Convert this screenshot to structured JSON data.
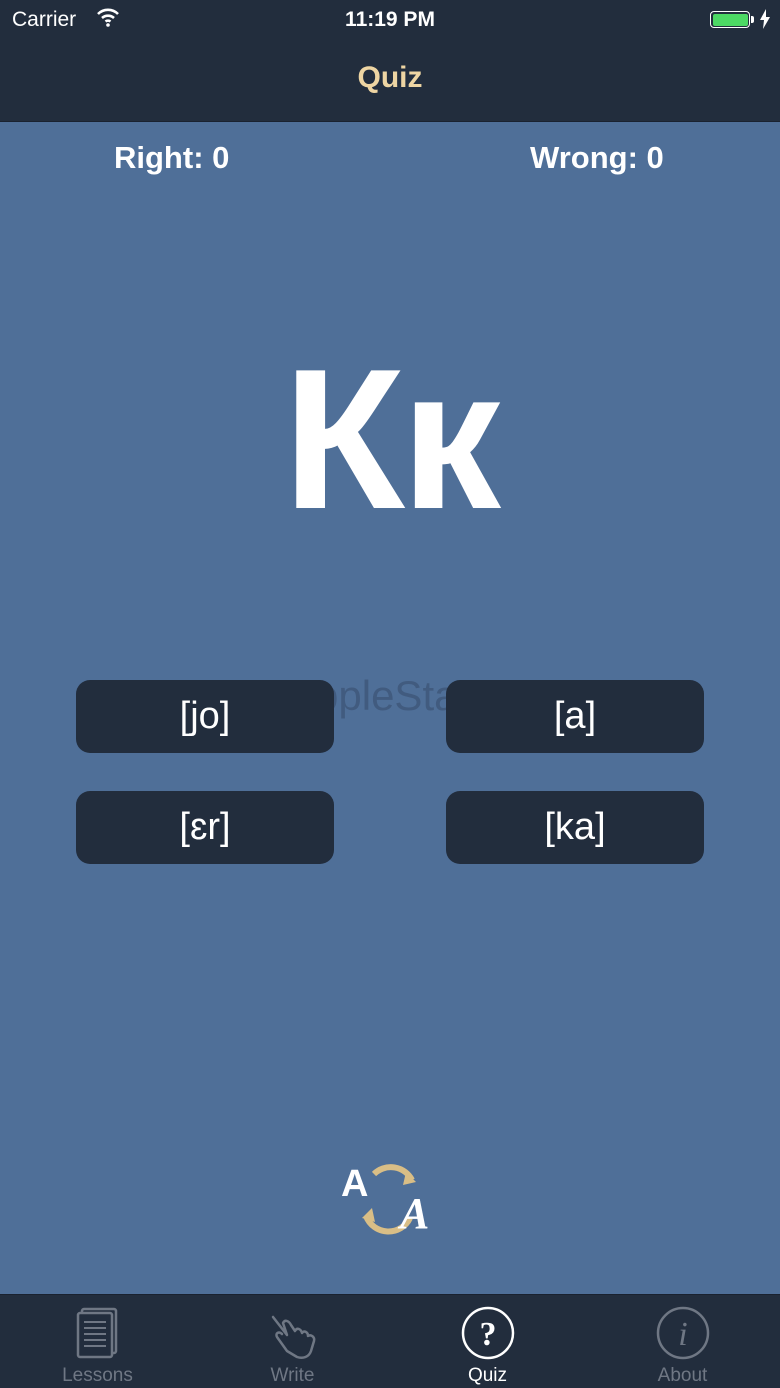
{
  "status_bar": {
    "carrier": "Carrier",
    "time": "11:19 PM"
  },
  "nav": {
    "title": "Quiz"
  },
  "score": {
    "right": "Right: 0",
    "wrong": "Wrong: 0"
  },
  "question": {
    "letter": "Кк"
  },
  "watermark": "JSAppleStar.com",
  "answers": [
    "[jo]",
    "[a]",
    "[ɛr]",
    "[ka]"
  ],
  "logo": {
    "letter_a": "A",
    "letter_script": "A"
  },
  "tabs": [
    {
      "label": "Lessons",
      "icon": "book-icon"
    },
    {
      "label": "Write",
      "icon": "hand-pointer-icon"
    },
    {
      "label": "Quiz",
      "icon": "question-icon",
      "active": true
    },
    {
      "label": "About",
      "icon": "info-icon"
    }
  ],
  "colors": {
    "background": "#4f6f98",
    "bar": "#222d3d",
    "accent": "#eed5a3"
  }
}
